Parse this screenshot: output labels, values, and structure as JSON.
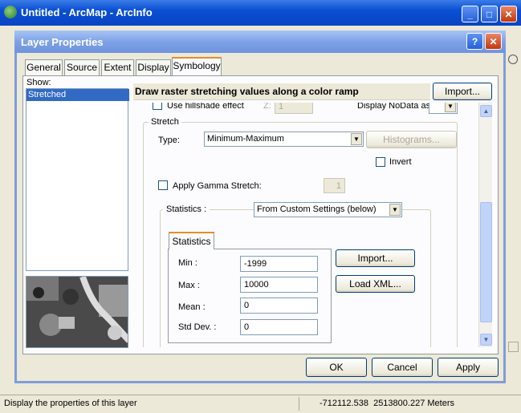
{
  "main_window": {
    "title": "Untitled - ArcMap - ArcInfo",
    "status_text": "Display the properties of this layer",
    "coordinates": "-712112.538  2513800.227 Meters"
  },
  "dialog": {
    "title": "Layer Properties",
    "tabs": [
      "General",
      "Source",
      "Extent",
      "Display",
      "Symbology"
    ],
    "active_tab": "Symbology",
    "show_label": "Show:",
    "show_items": [
      "Stretched"
    ],
    "description": "Draw raster stretching values along a color ramp",
    "import_label": "Import...",
    "hillshade_label": "Use hillshade effect",
    "z_label": "Z:",
    "z_value": "1",
    "nodata_label": "Display NoData as",
    "stretch": {
      "group_label": "Stretch",
      "type_label": "Type:",
      "type_value": "Minimum-Maximum",
      "histograms_label": "Histograms...",
      "invert_label": "Invert",
      "gamma_label": "Apply Gamma Stretch:",
      "gamma_value": "1"
    },
    "statistics": {
      "label": "Statistics :",
      "source_value": "From Custom Settings (below)",
      "tab_label": "Statistics",
      "min_label": "Min :",
      "min_value": "-1999",
      "max_label": "Max :",
      "max_value": "10000",
      "mean_label": "Mean :",
      "mean_value": "0",
      "std_label": "Std Dev. :",
      "std_value": "0",
      "import_label": "Import...",
      "load_xml_label": "Load XML..."
    },
    "buttons": {
      "ok": "OK",
      "cancel": "Cancel",
      "apply": "Apply"
    }
  },
  "colors": {
    "title_bar": "#0a4fd4",
    "dialog_title": "#7ea2e6",
    "selection": "#316ac5",
    "face": "#ece9d8"
  }
}
